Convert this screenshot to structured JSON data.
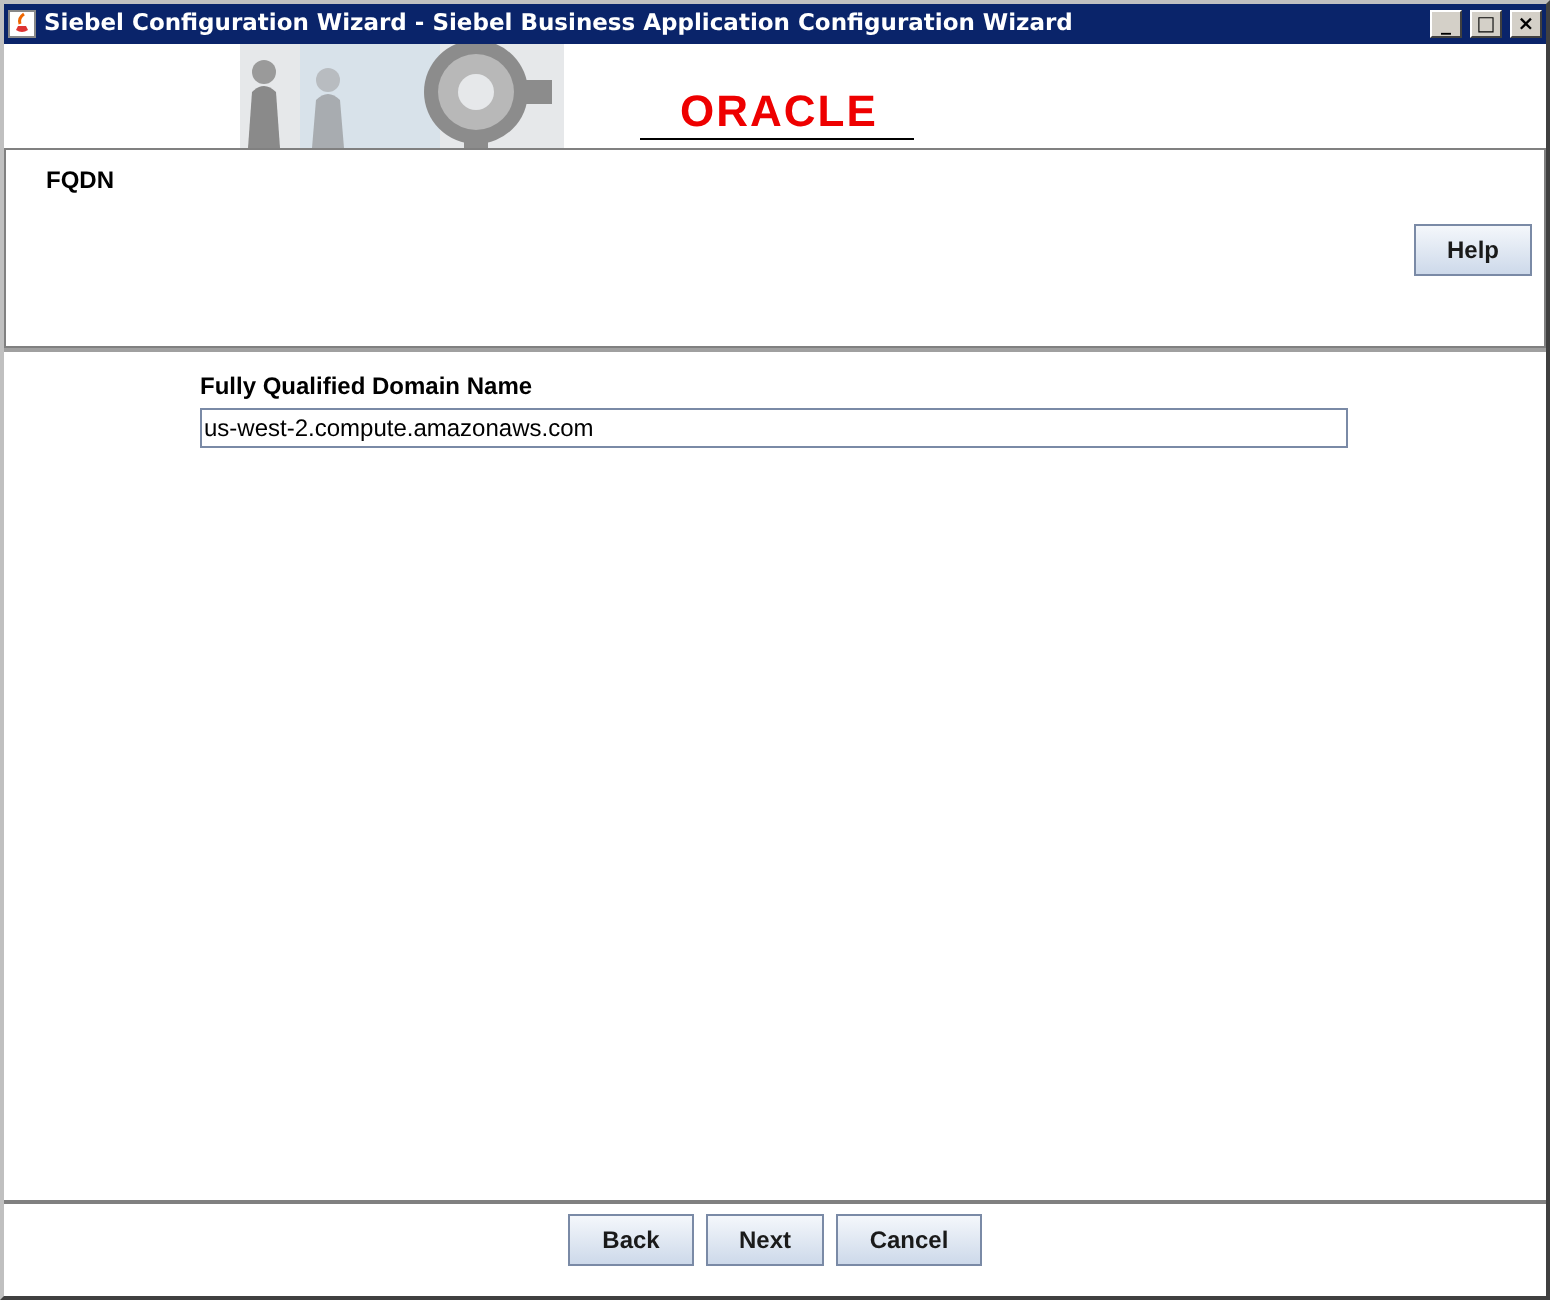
{
  "window": {
    "title": "Siebel Configuration Wizard - Siebel Business Application Configuration Wizard",
    "controls": [
      "_",
      "□",
      "×"
    ]
  },
  "banner": {
    "logo": "ORACLE"
  },
  "header": {
    "title": "FQDN",
    "help_button": "Help"
  },
  "form": {
    "label": "Fully Qualified Domain Name",
    "value": "us-west-2.compute.amazonaws.com"
  },
  "buttons": [
    "Back",
    "Next",
    "Cancel"
  ]
}
